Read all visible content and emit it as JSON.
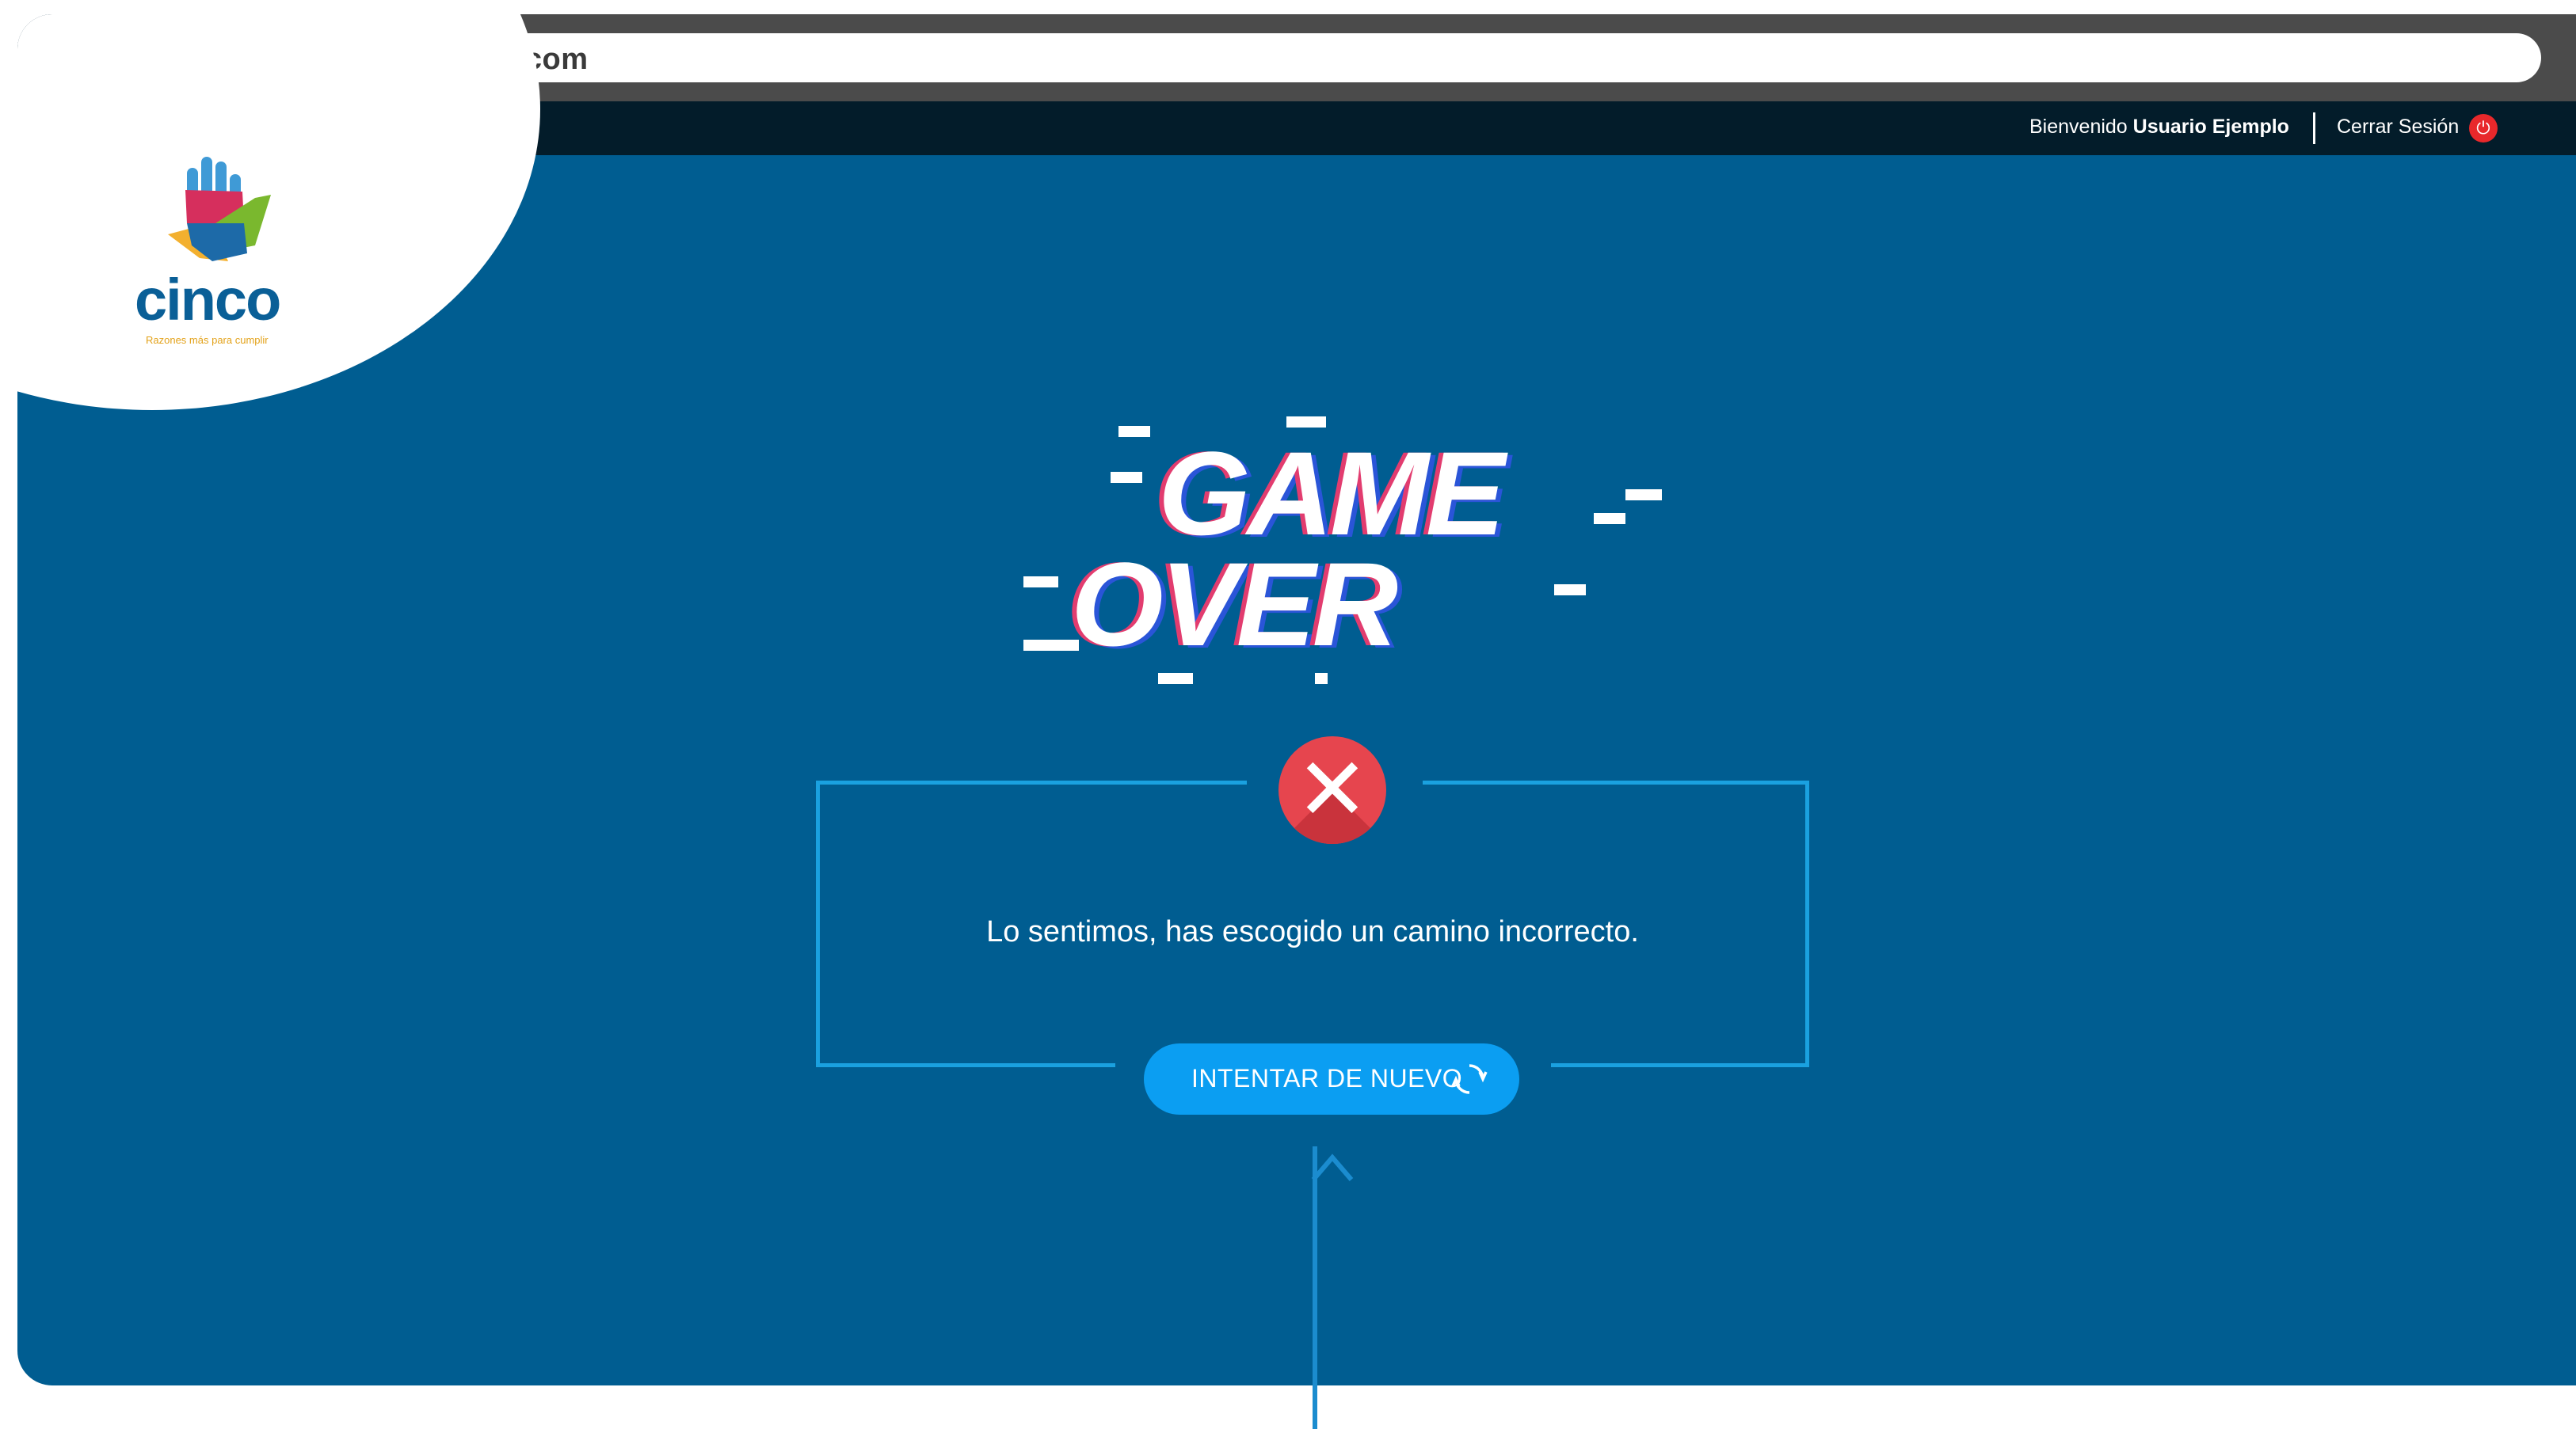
{
  "browser": {
    "url": "www.cincobmm.com"
  },
  "header": {
    "welcome_prefix": "Bienvenido",
    "user_name": "Usuario Ejemplo",
    "logout_label": "Cerrar Sesión",
    "logout_icon": "power-icon"
  },
  "logo": {
    "word": "cinco",
    "tagline": "Razones más para cumplir"
  },
  "game_over": {
    "line1": "GAME",
    "line2": "OVER"
  },
  "dialog": {
    "status_icon": "close-x-icon",
    "message": "Lo sentimos, has escogido un camino incorrecto.",
    "retry_label": "INTENTAR DE NUEVO",
    "retry_icon": "refresh-icon"
  },
  "colors": {
    "background": "#005d91",
    "topbar": "#031c2a",
    "accent_button": "#0b9ef2",
    "border": "#1aa1e0",
    "error": "#e6454e"
  }
}
